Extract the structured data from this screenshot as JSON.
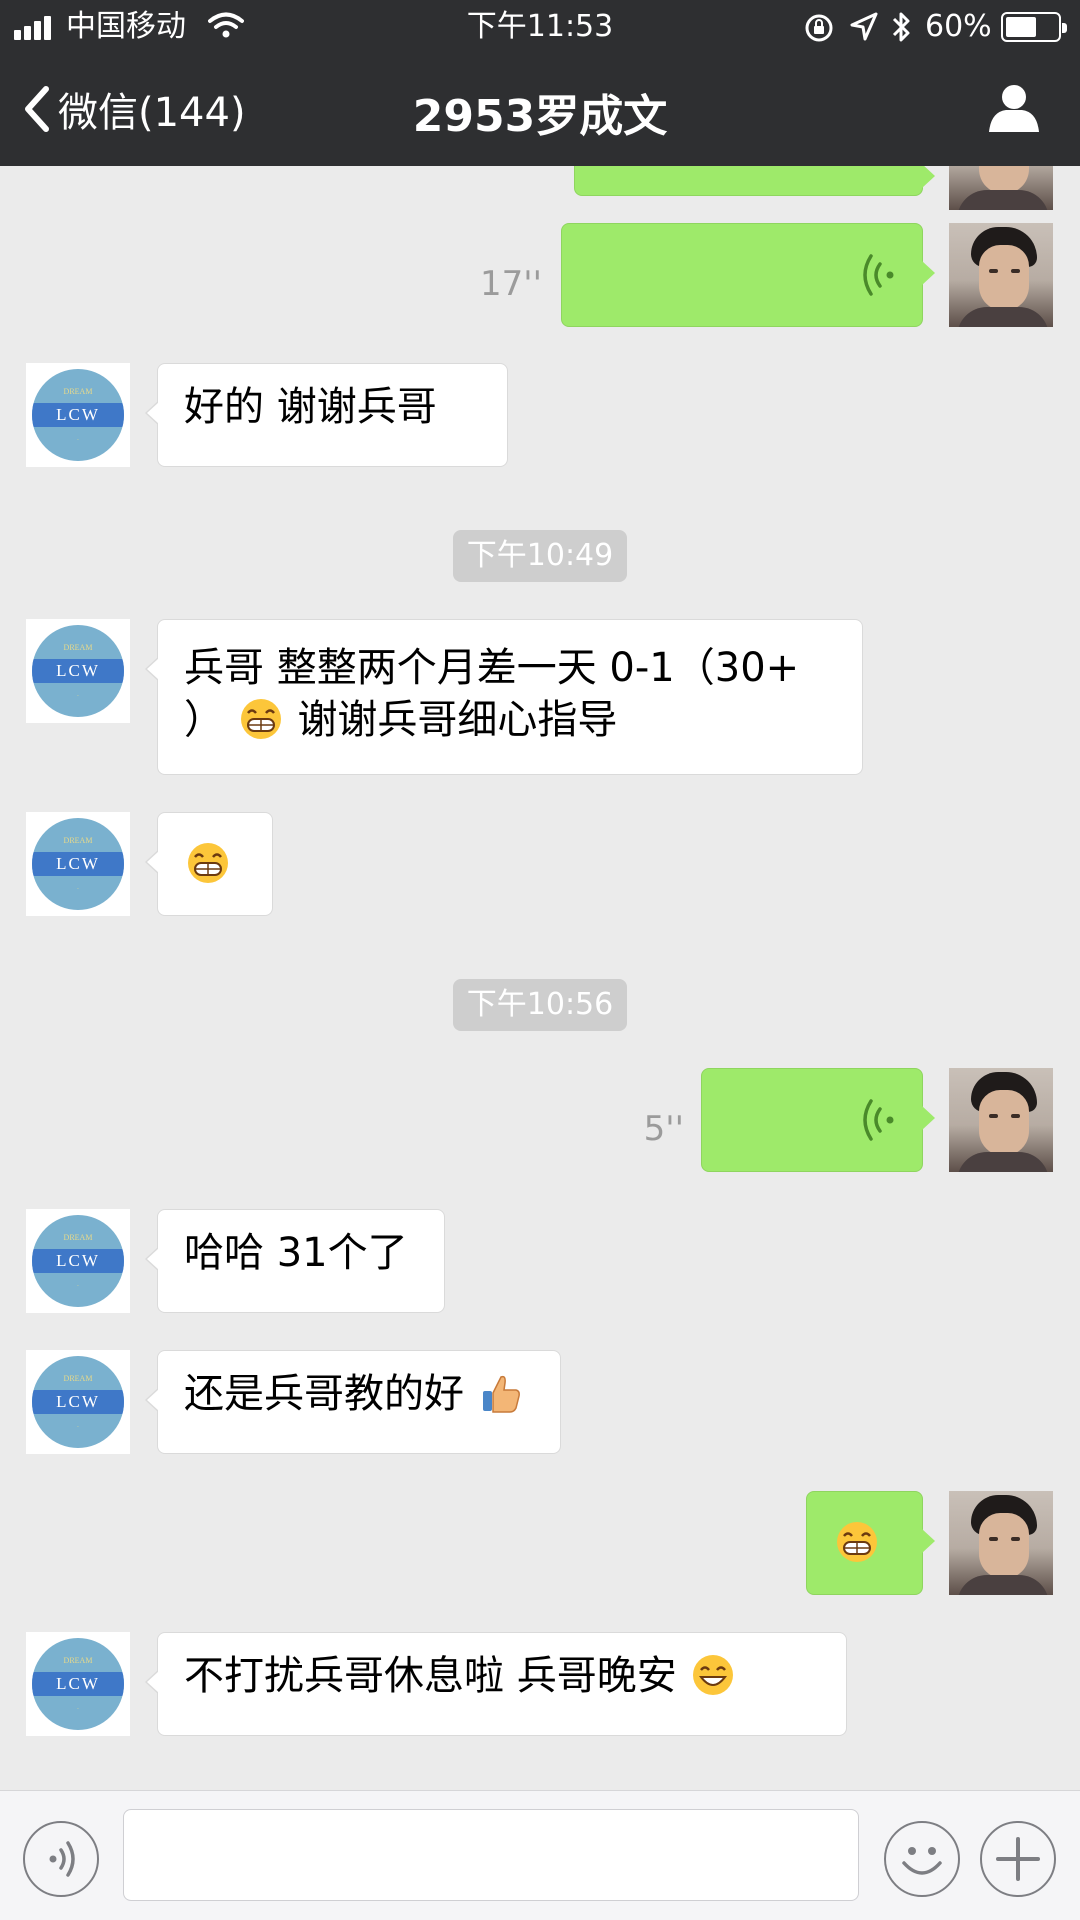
{
  "status_bar": {
    "carrier": "中国移动",
    "time": "下午11:53",
    "battery_percent": "60%",
    "battery_level": 0.6
  },
  "nav": {
    "back_label": "微信(144)",
    "title": "2953罗成文"
  },
  "messages": [
    {
      "id": "m0",
      "type": "voice",
      "direction": "out",
      "note": "partially scrolled off top"
    },
    {
      "id": "m1",
      "type": "voice",
      "direction": "out",
      "duration": "17''"
    },
    {
      "id": "m2",
      "type": "text",
      "direction": "in",
      "text": "好的  谢谢兵哥"
    },
    {
      "id": "t1",
      "type": "timestamp",
      "text": "下午10:49"
    },
    {
      "id": "m3",
      "type": "text",
      "direction": "in",
      "line1": "兵哥  整整两个月差一天  0-1（30+",
      "line2_pre": "）",
      "emoji": "grin-emoji",
      "line2_post": "  谢谢兵哥细心指导"
    },
    {
      "id": "m4",
      "type": "emoji",
      "direction": "in",
      "emoji": "grin-emoji"
    },
    {
      "id": "t2",
      "type": "timestamp",
      "text": "下午10:56"
    },
    {
      "id": "m5",
      "type": "voice",
      "direction": "out",
      "duration": "5''"
    },
    {
      "id": "m6",
      "type": "text",
      "direction": "in",
      "text": "哈哈  31个了"
    },
    {
      "id": "m7",
      "type": "text",
      "direction": "in",
      "text": "还是兵哥教的好",
      "emoji": "thumbs-up-emoji"
    },
    {
      "id": "m8",
      "type": "emoji",
      "direction": "out",
      "emoji": "grin-emoji"
    },
    {
      "id": "m9",
      "type": "text",
      "direction": "in",
      "text": "不打扰兵哥休息啦   兵哥晚安",
      "emoji": "smile-emoji"
    }
  ],
  "avatars": {
    "contact": {
      "name": "lcw-avatar",
      "top_text": "DREAM",
      "center_text": "LCW"
    },
    "me": {
      "name": "user-photo-avatar"
    }
  },
  "input_bar": {
    "voice_button": "voice-toggle-icon",
    "text_value": "",
    "emoji_button": "emoji-face-icon",
    "more_button": "plus-icon"
  },
  "colors": {
    "header_bg": "#2e2f31",
    "chat_bg": "#ebebeb",
    "outgoing_bubble": "#9eea6a",
    "incoming_bubble": "#ffffff",
    "timestamp_bg": "#cecece"
  }
}
